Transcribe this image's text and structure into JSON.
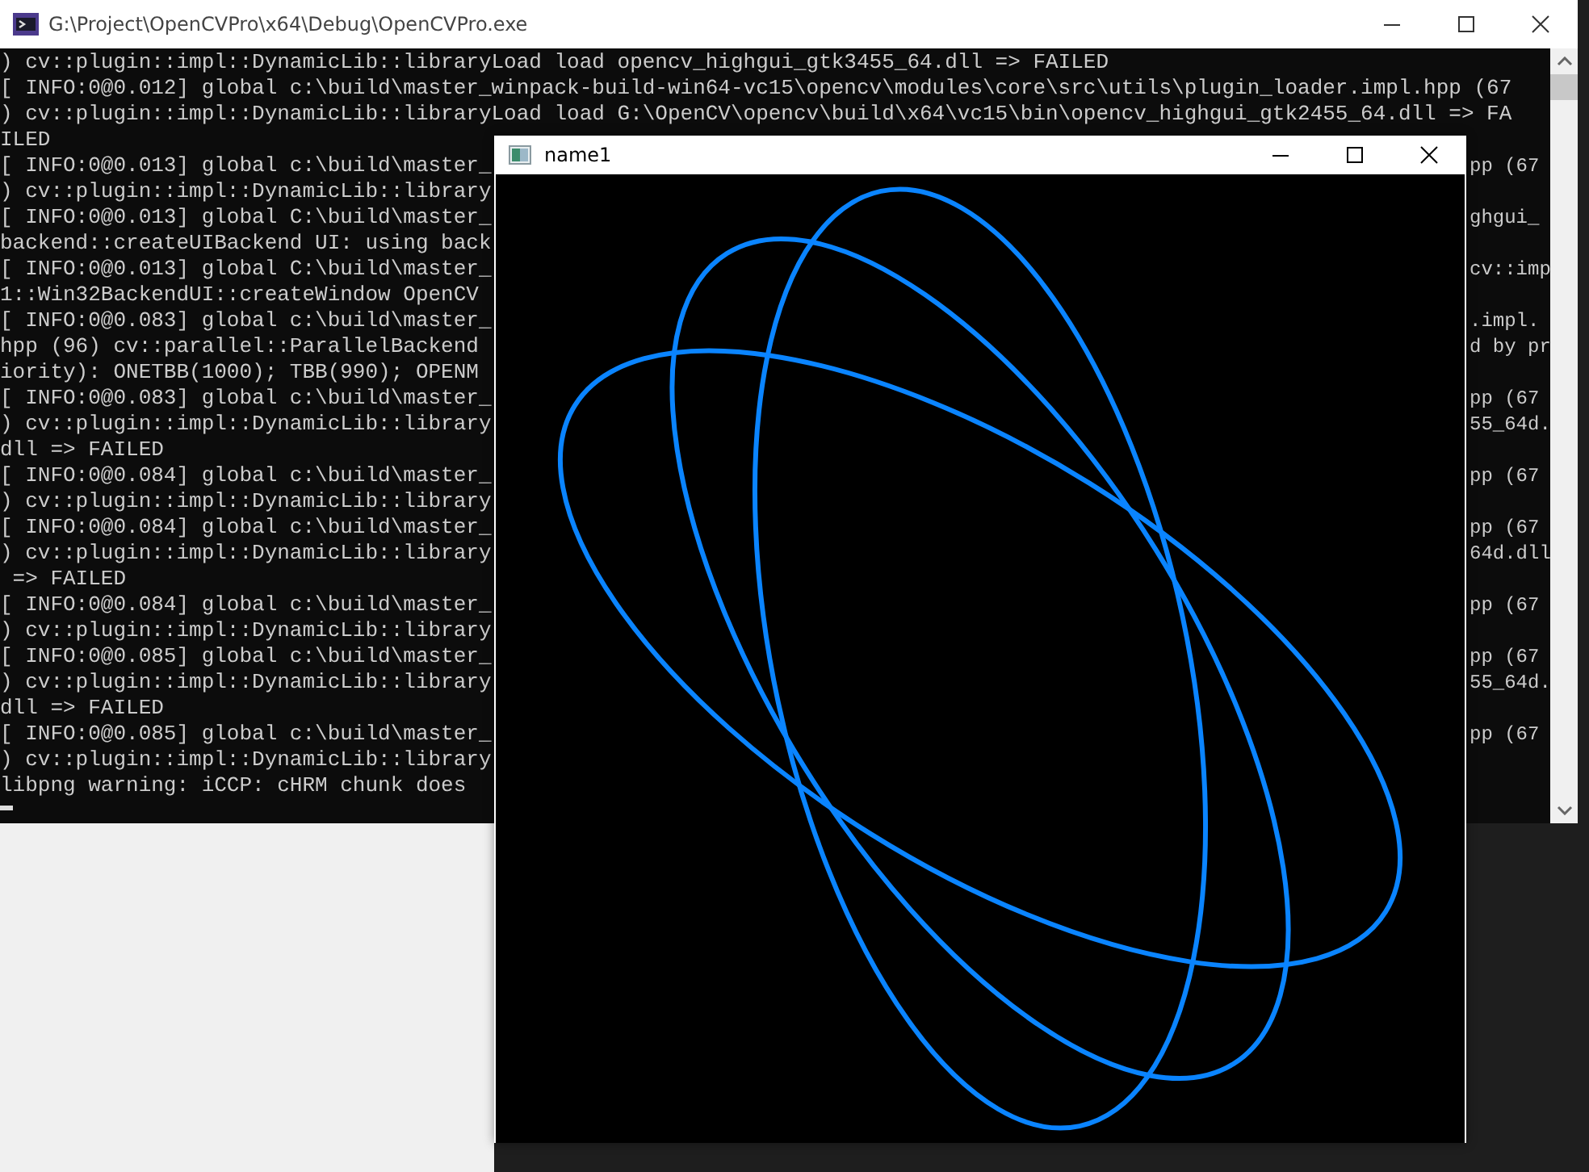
{
  "console_window": {
    "title": "G:\\Project\\OpenCVPro\\x64\\Debug\\OpenCVPro.exe",
    "lines": [
      {
        "left": ") cv::plugin::impl::DynamicLib::libraryLoad load opencv_highgui_gtk3455_64.dll => FAILED"
      },
      {
        "left": "[ INFO:0@0.012] global c:\\build\\master_winpack-build-win64-vc15\\opencv\\modules\\core\\src\\utils\\plugin_loader.impl.hpp (67"
      },
      {
        "left": ") cv::plugin::impl::DynamicLib::libraryLoad load G:\\OpenCV\\opencv\\build\\x64\\vc15\\bin\\opencv_highgui_gtk2455_64.dll => FA"
      },
      {
        "left": "ILED"
      },
      {
        "left": "[ INFO:0@0.013] global c:\\build\\master_",
        "right": "pp (67"
      },
      {
        "left": ") cv::plugin::impl::DynamicLib::library"
      },
      {
        "left": "[ INFO:0@0.013] global C:\\build\\master_",
        "right": "ghgui_"
      },
      {
        "left": "backend::createUIBackend UI: using back"
      },
      {
        "left": "[ INFO:0@0.013] global C:\\build\\master_",
        "right": "cv::imp"
      },
      {
        "left": "1::Win32BackendUI::createWindow OpenCV"
      },
      {
        "left": "[ INFO:0@0.083] global c:\\build\\master_",
        "right": ".impl."
      },
      {
        "left": "hpp (96) cv::parallel::ParallelBackend",
        "right": "d by pr"
      },
      {
        "left": "iority): ONETBB(1000); TBB(990); OPENM"
      },
      {
        "left": "[ INFO:0@0.083] global c:\\build\\master_",
        "right": "pp (67"
      },
      {
        "left": ") cv::plugin::impl::DynamicLib::library",
        "right": "55_64d."
      },
      {
        "left": "dll => FAILED"
      },
      {
        "left": "[ INFO:0@0.084] global c:\\build\\master_",
        "right": "pp (67"
      },
      {
        "left": ") cv::plugin::impl::DynamicLib::library"
      },
      {
        "left": "[ INFO:0@0.084] global c:\\build\\master_",
        "right": "pp (67"
      },
      {
        "left": ") cv::plugin::impl::DynamicLib::library",
        "right": "64d.dll"
      },
      {
        "left": " => FAILED"
      },
      {
        "left": "[ INFO:0@0.084] global c:\\build\\master_",
        "right": "pp (67"
      },
      {
        "left": ") cv::plugin::impl::DynamicLib::library"
      },
      {
        "left": "[ INFO:0@0.085] global c:\\build\\master_",
        "right": "pp (67"
      },
      {
        "left": ") cv::plugin::impl::DynamicLib::library",
        "right": "55_64d."
      },
      {
        "left": "dll => FAILED"
      },
      {
        "left": "[ INFO:0@0.085] global c:\\build\\master_",
        "right": "pp (67"
      },
      {
        "left": ") cv::plugin::impl::DynamicLib::library"
      },
      {
        "left": "libpng warning: iCCP: cHRM chunk does"
      }
    ]
  },
  "image_window": {
    "title": "name1"
  }
}
